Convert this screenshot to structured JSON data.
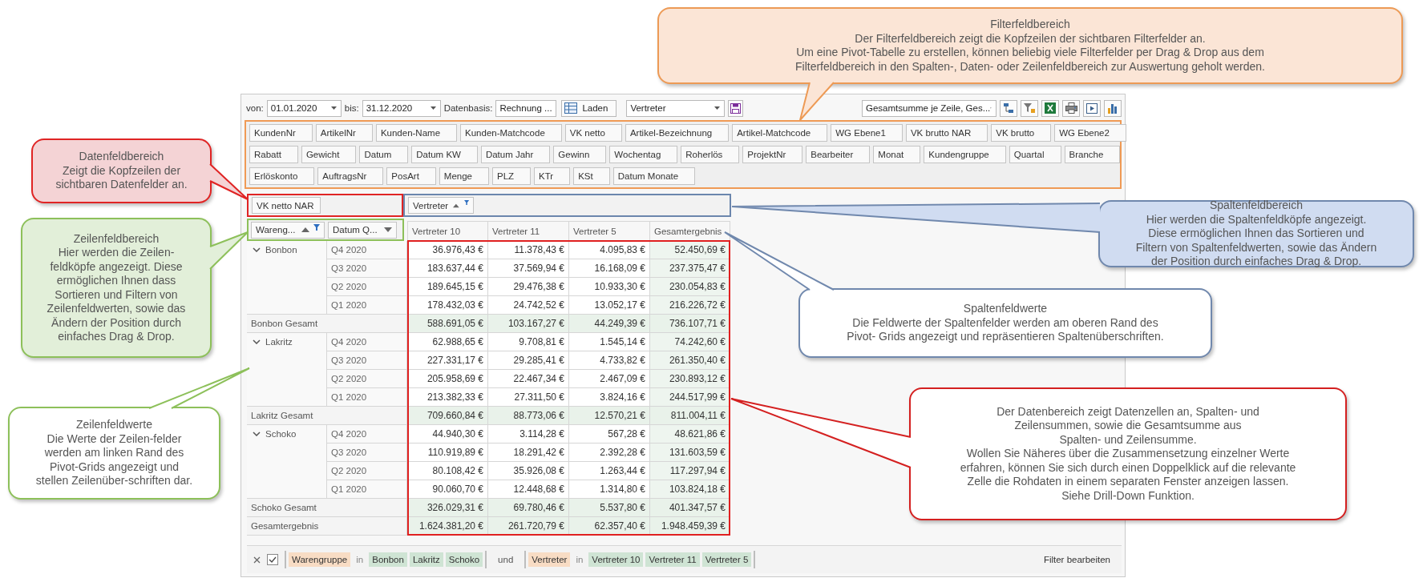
{
  "toolbar": {
    "from_label": "von:",
    "from_value": "01.01.2020",
    "to_label": "bis:",
    "to_value": "31.12.2020",
    "basis_label": "Datenbasis:",
    "basis_value": "Rechnung ...",
    "load_button": "Laden",
    "field_value": "Vertreter",
    "summary_value": "Gesamtsumme je Zeile, Ges..."
  },
  "filter_area": {
    "rows": [
      {
        "fields": [
          "KundenNr",
          "ArtikelNr",
          "Kunden-Name",
          "Kunden-Matchcode",
          "VK netto",
          "Artikel-Bezeichnung",
          "Artikel-Matchcode",
          "WG Ebene1",
          "VK brutto NAR",
          "VK brutto",
          "WG Ebene2"
        ]
      },
      {
        "fields": [
          "Rabatt",
          "Gewicht",
          "Datum",
          "Datum KW",
          "Datum Jahr",
          "Gewinn",
          "Wochentag",
          "Roherlös",
          "ProjektNr",
          "Bearbeiter",
          "Monat",
          "Kundengruppe",
          "Quartal",
          "Branche"
        ]
      },
      {
        "fields": [
          "Erlöskonto",
          "AuftragsNr",
          "PosArt",
          "Menge",
          "PLZ",
          "KTr",
          "KSt",
          "Datum Monate"
        ]
      }
    ]
  },
  "data_fields": [
    {
      "label": "VK netto NAR"
    }
  ],
  "column_fields": [
    {
      "label": "Vertreter",
      "sorted_ascending": true,
      "filtered": true
    }
  ],
  "row_fields": [
    {
      "label": "Wareng...",
      "sorted_ascending": true,
      "filtered": true
    },
    {
      "label": "Datum Q...",
      "sorted_ascending": false,
      "filtered": false
    }
  ],
  "grid": {
    "columns": [
      "Vertreter 10",
      "Vertreter 11",
      "Vertreter 5",
      "Gesamtergebnis"
    ],
    "groups": [
      {
        "label": "Bonbon",
        "expanded": true,
        "rows": [
          {
            "label": "Q4 2020",
            "values": [
              "36.976,43 €",
              "11.378,43 €",
              "4.095,83 €",
              "52.450,69 €"
            ]
          },
          {
            "label": "Q3 2020",
            "values": [
              "183.637,44 €",
              "37.569,94 €",
              "16.168,09 €",
              "237.375,47 €"
            ]
          },
          {
            "label": "Q2 2020",
            "values": [
              "189.645,15 €",
              "29.476,38 €",
              "10.933,30 €",
              "230.054,83 €"
            ]
          },
          {
            "label": "Q1 2020",
            "values": [
              "178.432,03 €",
              "24.742,52 €",
              "13.052,17 €",
              "216.226,72 €"
            ]
          }
        ],
        "total": {
          "label": "Bonbon Gesamt",
          "values": [
            "588.691,05 €",
            "103.167,27 €",
            "44.249,39 €",
            "736.107,71 €"
          ]
        }
      },
      {
        "label": "Lakritz",
        "expanded": true,
        "rows": [
          {
            "label": "Q4 2020",
            "values": [
              "62.988,65 €",
              "9.708,81 €",
              "1.545,14 €",
              "74.242,60 €"
            ]
          },
          {
            "label": "Q3 2020",
            "values": [
              "227.331,17 €",
              "29.285,41 €",
              "4.733,82 €",
              "261.350,40 €"
            ]
          },
          {
            "label": "Q2 2020",
            "values": [
              "205.958,69 €",
              "22.467,34 €",
              "2.467,09 €",
              "230.893,12 €"
            ]
          },
          {
            "label": "Q1 2020",
            "values": [
              "213.382,33 €",
              "27.311,50 €",
              "3.824,16 €",
              "244.517,99 €"
            ]
          }
        ],
        "total": {
          "label": "Lakritz Gesamt",
          "values": [
            "709.660,84 €",
            "88.773,06 €",
            "12.570,21 €",
            "811.004,11 €"
          ]
        }
      },
      {
        "label": "Schoko",
        "expanded": true,
        "rows": [
          {
            "label": "Q4 2020",
            "values": [
              "44.940,30 €",
              "3.114,28 €",
              "567,28 €",
              "48.621,86 €"
            ]
          },
          {
            "label": "Q3 2020",
            "values": [
              "110.919,89 €",
              "18.291,42 €",
              "2.392,28 €",
              "131.603,59 €"
            ]
          },
          {
            "label": "Q2 2020",
            "values": [
              "80.108,42 €",
              "35.926,08 €",
              "1.263,44 €",
              "117.297,94 €"
            ]
          },
          {
            "label": "Q1 2020",
            "values": [
              "90.060,70 €",
              "12.448,68 €",
              "1.314,80 €",
              "103.824,18 €"
            ]
          }
        ],
        "total": {
          "label": "Schoko Gesamt",
          "values": [
            "326.029,31 €",
            "69.780,46 €",
            "5.537,80 €",
            "401.347,57 €"
          ]
        }
      }
    ],
    "grand_total": {
      "label": "Gesamtergebnis",
      "values": [
        "1.624.381,20 €",
        "261.720,79 €",
        "62.357,40 €",
        "1.948.459,39 €"
      ]
    }
  },
  "filter_bar": {
    "enabled": true,
    "clauses": [
      {
        "field": "Warengruppe",
        "operator": "in",
        "values": [
          "Bonbon",
          "Lakritz",
          "Schoko"
        ]
      },
      {
        "field": "Vertreter",
        "operator": "in",
        "values": [
          "Vertreter 10",
          "Vertreter 11",
          "Vertreter 5"
        ]
      }
    ],
    "conjunction": "und",
    "edit_link": "Filter bearbeiten"
  },
  "callouts": [
    {
      "kind": "filter",
      "text": "Filterfeldbereich\nDer Filterfeldbereich zeigt die Kopfzeilen der sichtbaren Filterfelder an.\nUm eine Pivot-Tabelle zu erstellen, können beliebig viele Filterfelder per Drag & Drop aus dem\nFilterfeldbereich in den Spalten-, Daten- oder Zeilenfeldbereich zur Auswertung geholt werden."
    },
    {
      "kind": "data",
      "text": "Datenfeldbereich\nZeigt die Kopfzeilen der\nsichtbaren Datenfelder an."
    },
    {
      "kind": "column-fields",
      "text": "Spaltenfeldbereich\nHier werden die Spaltenfeldköpfe angezeigt.\nDiese ermöglichen Ihnen das Sortieren und\nFiltern von Spaltenfeldwerten, sowie das Ändern\nder Position durch einfaches Drag & Drop."
    },
    {
      "kind": "row-fields",
      "text": "Zeilenfeldbereich\nHier werden die Zeilen-\nfeldköpfe angezeigt. Diese\nermöglichen Ihnen dass\nSortieren und Filtern von\nZeilenfeldwerten, sowie das\nÄndern der Position durch\neinfaches Drag & Drop."
    },
    {
      "kind": "column-values",
      "text": "Spaltenfeldwerte\nDie Feldwerte der Spaltenfelder werden am oberen Rand des\nPivot- Grids angezeigt und repräsentieren Spaltenüberschriften."
    },
    {
      "kind": "row-values",
      "text": "Zeilenfeldwerte\nDie Werte der Zeilen-felder\nwerden am linken Rand des\nPivot-Grids angezeigt und\nstellen Zeilenüber-schriften dar."
    },
    {
      "kind": "data-area",
      "text": "Der Datenbereich zeigt Datenzellen an, Spalten- und\nZeilensummen, sowie die Gesamtsumme aus\nSpalten- und Zeilensumme.\nWollen Sie Näheres über die Zusammensetzung einzelner Werte\nerfahren, können Sie sich durch einen Doppelklick auf die relevante\nZelle die Rohdaten in einem separaten Fenster anzeigen lassen.\nSiehe Drill-Down Funktion."
    }
  ]
}
